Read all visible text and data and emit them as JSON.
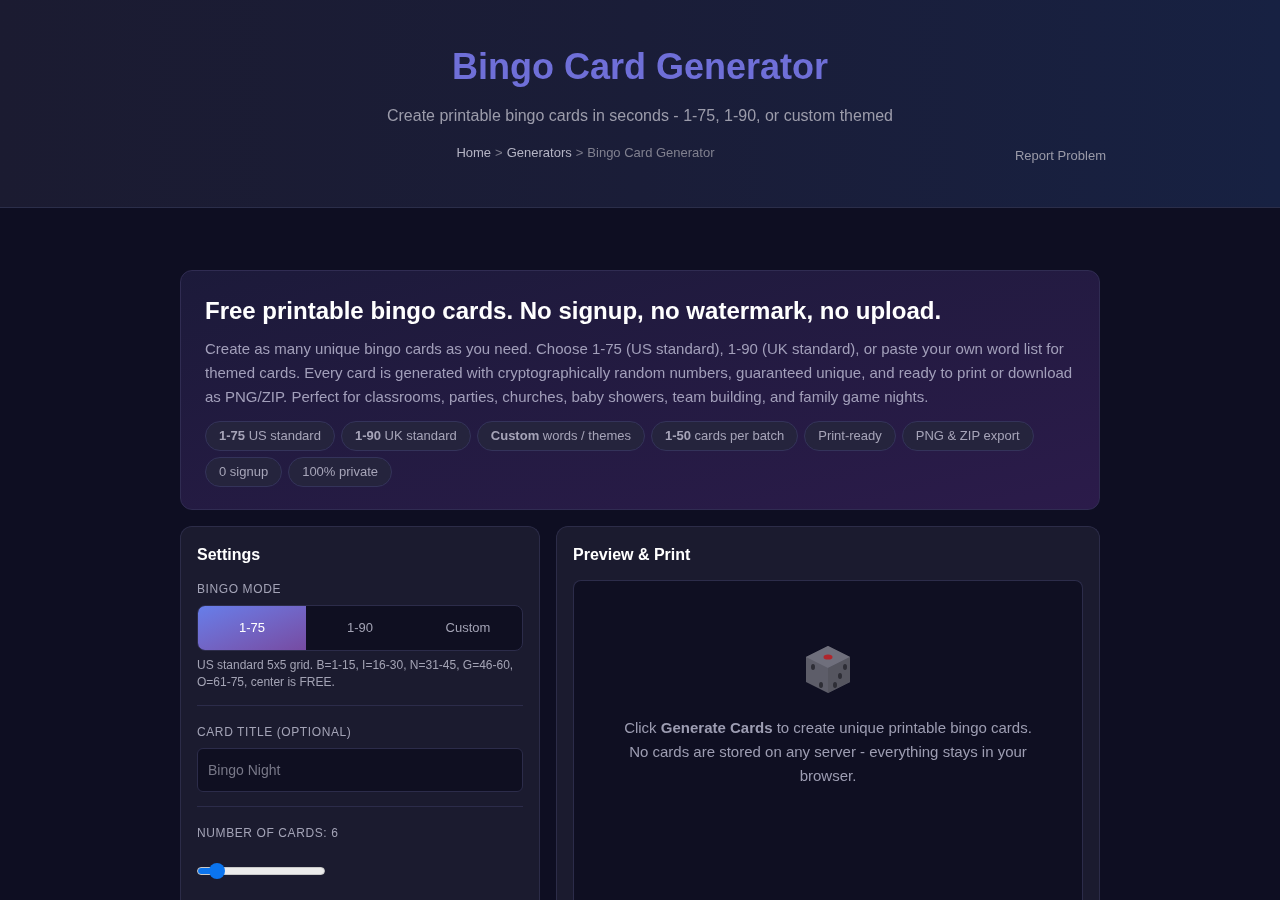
{
  "header": {
    "title": "Bingo Card Generator",
    "subtitle": "Create printable bingo cards in seconds - 1-75, 1-90, or custom themed",
    "breadcrumb": [
      {
        "kind": "link",
        "label": "Home"
      },
      {
        "kind": "separator",
        "label": ">"
      },
      {
        "kind": "link",
        "label": "Generators"
      },
      {
        "kind": "separator",
        "label": ">"
      },
      {
        "kind": "current",
        "label": "Bingo Card Generator"
      }
    ],
    "report_link": "Report Problem"
  },
  "intro": {
    "heading": "Free printable bingo cards. No signup, no watermark, no upload.",
    "body": "Create as many unique bingo cards as you need. Choose 1-75 (US standard), 1-90 (UK standard), or paste your own word list for themed cards. Every card is generated with cryptographically random numbers, guaranteed unique, and ready to print or download as PNG/ZIP. Perfect for classrooms, parties, churches, baby showers, team building, and family game nights.",
    "chips": [
      "**1-75** US standard",
      "**1-90** UK standard",
      "**Custom** words / themes",
      "**1-50** cards per batch",
      "Print-ready",
      "PNG & ZIP export",
      "0 signup",
      "100% private"
    ]
  },
  "settings": {
    "title": "Settings",
    "mode": {
      "label": "BINGO MODE",
      "options": [
        {
          "label": "1-75",
          "selected": true
        },
        {
          "label": "1-90",
          "selected": false
        },
        {
          "label": "Custom",
          "selected": false
        }
      ],
      "help": "US standard 5x5 grid. B=1-15, I=16-30, N=31-45, G=46-60, O=61-75, center is FREE."
    },
    "card_title": {
      "label": "CARD TITLE (OPTIONAL)",
      "placeholder": "Bingo Night"
    },
    "number_of_cards": {
      "label": "NUMBER OF CARDS: 6",
      "level": 0.1
    }
  },
  "preview": {
    "title": "Preview & Print",
    "message": "Click **Generate Cards** to create unique printable bingo cards. No cards are stored on any server - everything stays in your browser."
  }
}
